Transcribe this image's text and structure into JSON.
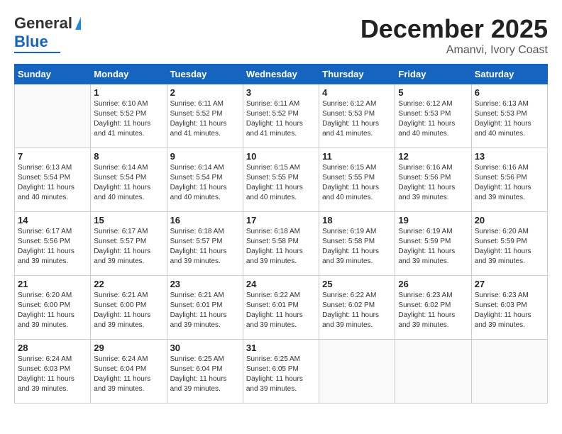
{
  "header": {
    "logo_line1": "General",
    "logo_line2": "Blue",
    "month": "December 2025",
    "location": "Amanvi, Ivory Coast"
  },
  "days_of_week": [
    "Sunday",
    "Monday",
    "Tuesday",
    "Wednesday",
    "Thursday",
    "Friday",
    "Saturday"
  ],
  "weeks": [
    [
      {
        "day": "",
        "sunrise": "",
        "sunset": "",
        "daylight": ""
      },
      {
        "day": "1",
        "sunrise": "Sunrise: 6:10 AM",
        "sunset": "Sunset: 5:52 PM",
        "daylight": "Daylight: 11 hours and 41 minutes."
      },
      {
        "day": "2",
        "sunrise": "Sunrise: 6:11 AM",
        "sunset": "Sunset: 5:52 PM",
        "daylight": "Daylight: 11 hours and 41 minutes."
      },
      {
        "day": "3",
        "sunrise": "Sunrise: 6:11 AM",
        "sunset": "Sunset: 5:52 PM",
        "daylight": "Daylight: 11 hours and 41 minutes."
      },
      {
        "day": "4",
        "sunrise": "Sunrise: 6:12 AM",
        "sunset": "Sunset: 5:53 PM",
        "daylight": "Daylight: 11 hours and 41 minutes."
      },
      {
        "day": "5",
        "sunrise": "Sunrise: 6:12 AM",
        "sunset": "Sunset: 5:53 PM",
        "daylight": "Daylight: 11 hours and 40 minutes."
      },
      {
        "day": "6",
        "sunrise": "Sunrise: 6:13 AM",
        "sunset": "Sunset: 5:53 PM",
        "daylight": "Daylight: 11 hours and 40 minutes."
      }
    ],
    [
      {
        "day": "7",
        "sunrise": "Sunrise: 6:13 AM",
        "sunset": "Sunset: 5:54 PM",
        "daylight": "Daylight: 11 hours and 40 minutes."
      },
      {
        "day": "8",
        "sunrise": "Sunrise: 6:14 AM",
        "sunset": "Sunset: 5:54 PM",
        "daylight": "Daylight: 11 hours and 40 minutes."
      },
      {
        "day": "9",
        "sunrise": "Sunrise: 6:14 AM",
        "sunset": "Sunset: 5:54 PM",
        "daylight": "Daylight: 11 hours and 40 minutes."
      },
      {
        "day": "10",
        "sunrise": "Sunrise: 6:15 AM",
        "sunset": "Sunset: 5:55 PM",
        "daylight": "Daylight: 11 hours and 40 minutes."
      },
      {
        "day": "11",
        "sunrise": "Sunrise: 6:15 AM",
        "sunset": "Sunset: 5:55 PM",
        "daylight": "Daylight: 11 hours and 40 minutes."
      },
      {
        "day": "12",
        "sunrise": "Sunrise: 6:16 AM",
        "sunset": "Sunset: 5:56 PM",
        "daylight": "Daylight: 11 hours and 39 minutes."
      },
      {
        "day": "13",
        "sunrise": "Sunrise: 6:16 AM",
        "sunset": "Sunset: 5:56 PM",
        "daylight": "Daylight: 11 hours and 39 minutes."
      }
    ],
    [
      {
        "day": "14",
        "sunrise": "Sunrise: 6:17 AM",
        "sunset": "Sunset: 5:56 PM",
        "daylight": "Daylight: 11 hours and 39 minutes."
      },
      {
        "day": "15",
        "sunrise": "Sunrise: 6:17 AM",
        "sunset": "Sunset: 5:57 PM",
        "daylight": "Daylight: 11 hours and 39 minutes."
      },
      {
        "day": "16",
        "sunrise": "Sunrise: 6:18 AM",
        "sunset": "Sunset: 5:57 PM",
        "daylight": "Daylight: 11 hours and 39 minutes."
      },
      {
        "day": "17",
        "sunrise": "Sunrise: 6:18 AM",
        "sunset": "Sunset: 5:58 PM",
        "daylight": "Daylight: 11 hours and 39 minutes."
      },
      {
        "day": "18",
        "sunrise": "Sunrise: 6:19 AM",
        "sunset": "Sunset: 5:58 PM",
        "daylight": "Daylight: 11 hours and 39 minutes."
      },
      {
        "day": "19",
        "sunrise": "Sunrise: 6:19 AM",
        "sunset": "Sunset: 5:59 PM",
        "daylight": "Daylight: 11 hours and 39 minutes."
      },
      {
        "day": "20",
        "sunrise": "Sunrise: 6:20 AM",
        "sunset": "Sunset: 5:59 PM",
        "daylight": "Daylight: 11 hours and 39 minutes."
      }
    ],
    [
      {
        "day": "21",
        "sunrise": "Sunrise: 6:20 AM",
        "sunset": "Sunset: 6:00 PM",
        "daylight": "Daylight: 11 hours and 39 minutes."
      },
      {
        "day": "22",
        "sunrise": "Sunrise: 6:21 AM",
        "sunset": "Sunset: 6:00 PM",
        "daylight": "Daylight: 11 hours and 39 minutes."
      },
      {
        "day": "23",
        "sunrise": "Sunrise: 6:21 AM",
        "sunset": "Sunset: 6:01 PM",
        "daylight": "Daylight: 11 hours and 39 minutes."
      },
      {
        "day": "24",
        "sunrise": "Sunrise: 6:22 AM",
        "sunset": "Sunset: 6:01 PM",
        "daylight": "Daylight: 11 hours and 39 minutes."
      },
      {
        "day": "25",
        "sunrise": "Sunrise: 6:22 AM",
        "sunset": "Sunset: 6:02 PM",
        "daylight": "Daylight: 11 hours and 39 minutes."
      },
      {
        "day": "26",
        "sunrise": "Sunrise: 6:23 AM",
        "sunset": "Sunset: 6:02 PM",
        "daylight": "Daylight: 11 hours and 39 minutes."
      },
      {
        "day": "27",
        "sunrise": "Sunrise: 6:23 AM",
        "sunset": "Sunset: 6:03 PM",
        "daylight": "Daylight: 11 hours and 39 minutes."
      }
    ],
    [
      {
        "day": "28",
        "sunrise": "Sunrise: 6:24 AM",
        "sunset": "Sunset: 6:03 PM",
        "daylight": "Daylight: 11 hours and 39 minutes."
      },
      {
        "day": "29",
        "sunrise": "Sunrise: 6:24 AM",
        "sunset": "Sunset: 6:04 PM",
        "daylight": "Daylight: 11 hours and 39 minutes."
      },
      {
        "day": "30",
        "sunrise": "Sunrise: 6:25 AM",
        "sunset": "Sunset: 6:04 PM",
        "daylight": "Daylight: 11 hours and 39 minutes."
      },
      {
        "day": "31",
        "sunrise": "Sunrise: 6:25 AM",
        "sunset": "Sunset: 6:05 PM",
        "daylight": "Daylight: 11 hours and 39 minutes."
      },
      {
        "day": "",
        "sunrise": "",
        "sunset": "",
        "daylight": ""
      },
      {
        "day": "",
        "sunrise": "",
        "sunset": "",
        "daylight": ""
      },
      {
        "day": "",
        "sunrise": "",
        "sunset": "",
        "daylight": ""
      }
    ]
  ]
}
